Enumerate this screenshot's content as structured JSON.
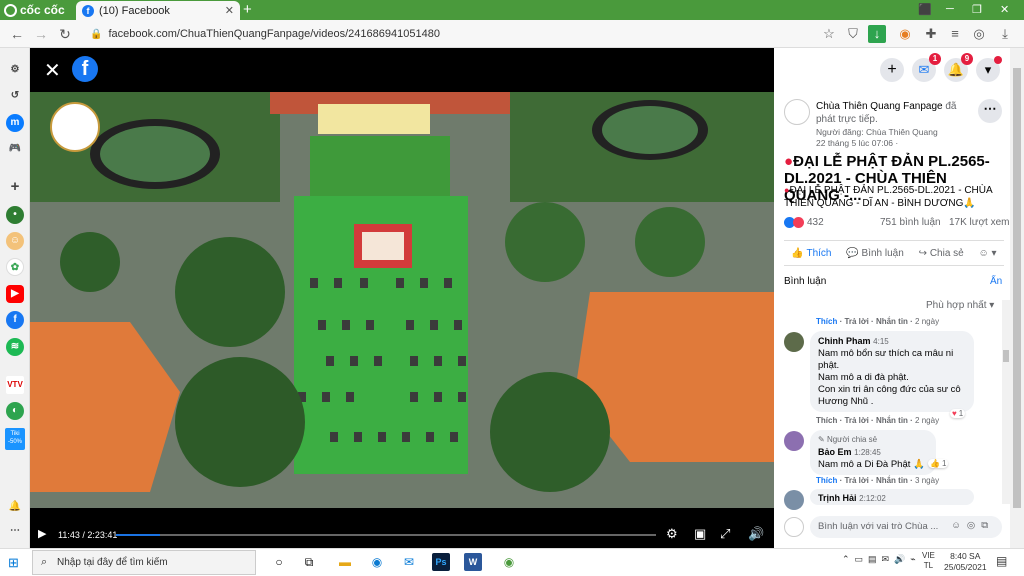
{
  "browser": {
    "app_name": "cốc cốc",
    "tab_title": "(10) Facebook",
    "url": "facebook.com/ChuaThienQuangFanpage/videos/241686941051480"
  },
  "video": {
    "current_time": "11:43",
    "duration": "2:23:41",
    "progress_fraction": 0.081
  },
  "fb_top": {
    "messenger_badge": "1",
    "notifications_badge": "9"
  },
  "post": {
    "page_name": "Chùa Thiên Quang Fanpage",
    "action_text": "đã phát trực tiếp.",
    "posted_by": "Người đăng: Chùa Thiên Quang",
    "date": "22 tháng 5 lúc 07:06 ·",
    "headline": "ĐẠI LỄ PHẬT ĐẢN PL.2565-DL.2021 - CHÙA THIÊN QUANG -...",
    "description": "ĐẠI LỄ PHẬT ĐẢN PL.2565-DL.2021 - CHÙA THIÊN QUANG - DĨ AN - BÌNH DƯƠNG🙏",
    "reactions_count": "432",
    "comments_count": "751 bình luận",
    "views": "17K lượt xem",
    "like_label": "Thích",
    "comment_label": "Bình luận",
    "share_label": "Chia sẻ"
  },
  "comments_section": {
    "heading": "Bình luận",
    "hide_label": "Ẩn",
    "sort_label": "Phù hợp nhất",
    "comments": [
      {
        "actions": [
          "Thích",
          "Trả lời",
          "Nhắn tin",
          "2 ngày"
        ],
        "reaction_count": "",
        "text": ""
      },
      {
        "name": "Chinh Pham",
        "time": "4:15",
        "text": "Nam mô bổn sư thích ca mâu ni phật.\nNam mô a di đà phật.\nCon xin tri ân công đức của sư cô Hương Nhũ .",
        "actions": [
          "Thích",
          "Trả lời",
          "Nhắn tin",
          "2 ngày"
        ],
        "reaction_count": "1"
      },
      {
        "shared_label": "Người chia sẻ",
        "name": "Bảo Em",
        "time": "1:28:45",
        "text": "Nam mô a Di Đà Phật 🙏",
        "actions": [
          "Thích",
          "Trả lời",
          "Nhắn tin",
          "3 ngày"
        ],
        "reaction_count": "1"
      },
      {
        "name": "Trịnh Hải",
        "time": "2:12:02",
        "text": ""
      }
    ],
    "reply_placeholder": "Bình luận với vai trò Chùa ..."
  },
  "taskbar": {
    "search_placeholder": "Nhập tại đây để tìm kiếm",
    "lang_top": "VIE",
    "lang_bottom": "TL",
    "time": "8:40 SA",
    "date": "25/05/2021"
  },
  "sidebar_badge": "Tiki -50%"
}
